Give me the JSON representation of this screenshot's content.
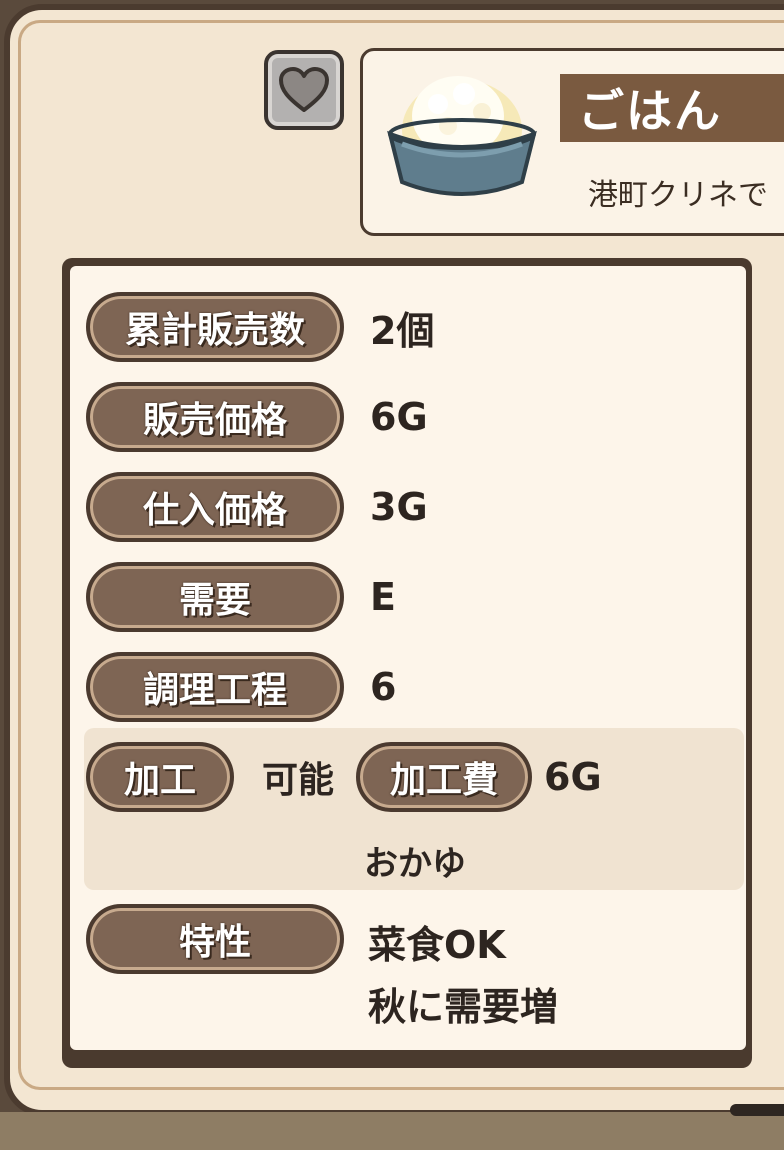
{
  "item": {
    "name": "ごはん",
    "description": "港町クリネで",
    "icon": "rice-bowl-icon"
  },
  "favorite": {
    "icon": "heart-icon"
  },
  "stats": [
    {
      "label": "累計販売数",
      "value": "2個"
    },
    {
      "label": "販売価格",
      "value": "6G"
    },
    {
      "label": "仕入価格",
      "value": "3G"
    },
    {
      "label": "需要",
      "value": "E"
    },
    {
      "label": "調理工程",
      "value": "6"
    }
  ],
  "processing": {
    "label": "加工",
    "status": "可能",
    "cost_label": "加工費",
    "cost_value": "6G",
    "result": "おかゆ"
  },
  "traits": {
    "label": "特性",
    "values": [
      "菜食OK",
      "秋に需要増"
    ]
  },
  "colors": {
    "pill_fill": "#7e6554",
    "banner": "#7a5a40",
    "paper": "#fdf5ea",
    "frame": "#4b3b2f"
  }
}
